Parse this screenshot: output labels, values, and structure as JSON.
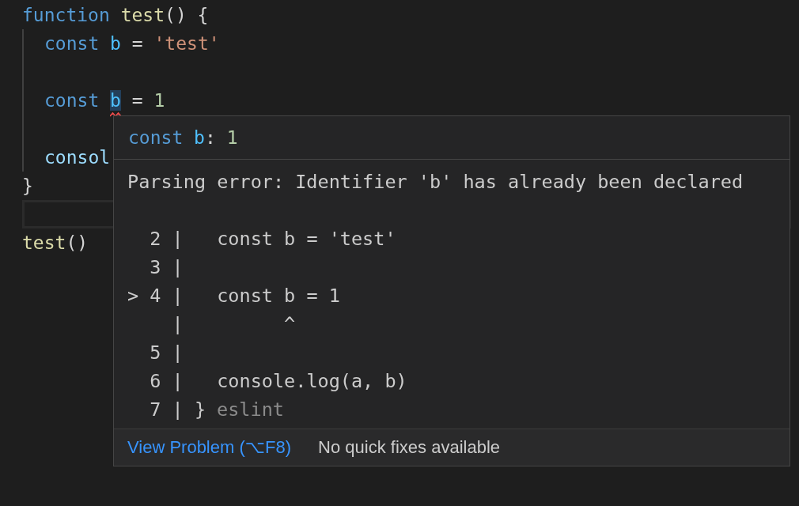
{
  "editor": {
    "lines": [
      {
        "current": false,
        "tokens": [
          {
            "kind": "keyword",
            "text": "function"
          },
          {
            "kind": "function",
            "text": " test"
          },
          {
            "kind": "plain",
            "text": "() {"
          }
        ]
      },
      {
        "current": false,
        "indented": true,
        "tokens": [
          {
            "kind": "keyword",
            "text": "const"
          },
          {
            "kind": "variable",
            "text": " b"
          },
          {
            "kind": "plain",
            "text": " = "
          },
          {
            "kind": "string",
            "text": "'test'"
          }
        ]
      },
      {
        "current": false,
        "gap_before": true,
        "indented": true,
        "tokens": [
          {
            "kind": "keyword",
            "text": "const "
          },
          {
            "kind": "error",
            "text": "b"
          },
          {
            "kind": "plain",
            "text": " = "
          },
          {
            "kind": "number",
            "text": "1"
          }
        ]
      },
      {
        "current": false,
        "gap_before": true,
        "indented": true,
        "tokens": [
          {
            "kind": "property",
            "text": "consol"
          }
        ]
      },
      {
        "current": false,
        "tokens": [
          {
            "kind": "plain",
            "text": "}"
          }
        ]
      },
      {
        "current": true
      },
      {
        "current": false,
        "tokens": [
          {
            "kind": "function",
            "text": "test"
          },
          {
            "kind": "plain",
            "text": "()"
          }
        ]
      }
    ]
  },
  "hover": {
    "signature": [
      {
        "kind": "keyword",
        "text": "const"
      },
      {
        "kind": "variable",
        "text": " b"
      },
      {
        "kind": "plain",
        "text": ": "
      },
      {
        "kind": "number",
        "text": "1"
      }
    ],
    "message": "Parsing error: Identifier 'b' has already been declared",
    "frame": [
      {
        "gutter": "  2 |",
        "code": "   const b = 'test'"
      },
      {
        "gutter": "  3 |"
      },
      {
        "gutter": "> 4 |",
        "code": "   const b = 1"
      },
      {
        "gutter": "    |",
        "code": "         ^"
      },
      {
        "gutter": "  5 |"
      },
      {
        "gutter": "  6 |",
        "code": "   console.log(a, b)"
      },
      {
        "gutter": "  7 |",
        "code": " }"
      }
    ],
    "source": "eslint",
    "link": "View Problem (⌥F8)",
    "status": "No quick fixes available"
  }
}
